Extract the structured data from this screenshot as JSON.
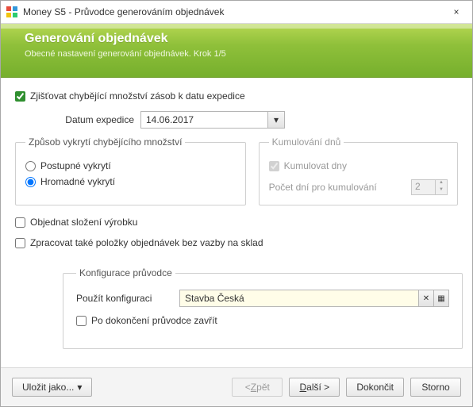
{
  "window": {
    "title": "Money S5 - Průvodce generováním objednávek",
    "close_icon": "×"
  },
  "header": {
    "title": "Generování objednávek",
    "subtitle": "Obecné nastavení generování objednávek. Krok 1/5"
  },
  "options": {
    "detect_missing_label": "Zjišťovat chybějící množství zásob k datu expedice",
    "detect_missing_checked": true,
    "date_label": "Datum expedice",
    "date_value": "14.06.2017"
  },
  "cover": {
    "legend": "Způsob vykrytí chybějícího množství",
    "postupne": "Postupné vykrytí",
    "hromadne": "Hromadné vykrytí",
    "selected": "hromadne"
  },
  "kum": {
    "legend": "Kumulování dnů",
    "kumulovat": "Kumulovat dny",
    "kumulovat_checked": true,
    "pocet_label": "Počet dní pro kumulování",
    "pocet_value": "2"
  },
  "extra": {
    "objednat_label": "Objednat složení výrobku",
    "objednat_checked": false,
    "zpracovat_label": "Zpracovat také položky objednávek bez vazby na sklad",
    "zpracovat_checked": false
  },
  "config": {
    "legend": "Konfigurace průvodce",
    "use_label": "Použít konfiguraci",
    "use_value": "Stavba Česká",
    "close_after_label": "Po dokončení průvodce zavřít",
    "close_after_checked": false
  },
  "footer": {
    "save_as": "Uložit jako...",
    "back_prefix": "< ",
    "back_hot": "Z",
    "back_rest": "pět",
    "next_hot": "D",
    "next_rest": "alší >",
    "finish": "Dokončit",
    "cancel": "Storno"
  },
  "icons": {
    "clear": "✕",
    "browse": "▦",
    "dropdown": "▾",
    "up": "▲",
    "down": "▼"
  }
}
